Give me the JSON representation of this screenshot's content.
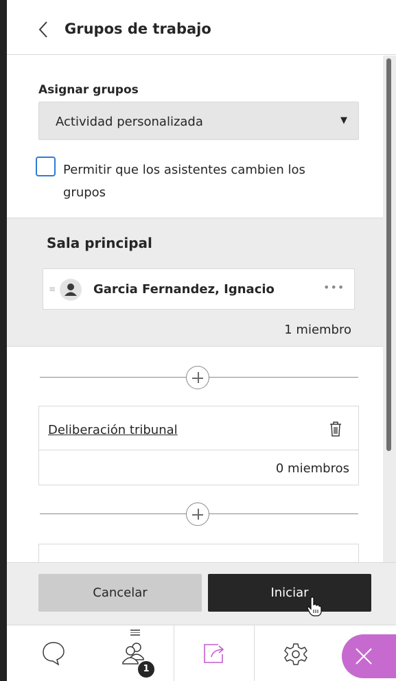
{
  "header": {
    "title": "Grupos de trabajo"
  },
  "assign": {
    "label": "Asignar grupos",
    "selected": "Actividad personalizada",
    "allow_switch_label": "Permitir que los asistentes cambien los grupos",
    "allow_switch_checked": false
  },
  "main_room": {
    "title": "Sala principal",
    "members": [
      {
        "name": "Garcia Fernandez, Ignacio"
      }
    ],
    "count": "1 miembro"
  },
  "groups": [
    {
      "name": "Deliberación tribunal",
      "count": "0 miembros"
    }
  ],
  "footer": {
    "cancel_label": "Cancelar",
    "start_label": "Iniciar"
  },
  "nav": {
    "items": [
      "chat-icon",
      "attendees-icon",
      "share-content-icon",
      "settings-icon",
      "close-icon"
    ],
    "attendees_badge": "1",
    "active": "share-content-icon"
  },
  "colors": {
    "accent_checkbox": "#2e7bd6",
    "close_button": "#c76ad0",
    "share_icon": "#c35bd0",
    "primary_button": "#262626"
  }
}
